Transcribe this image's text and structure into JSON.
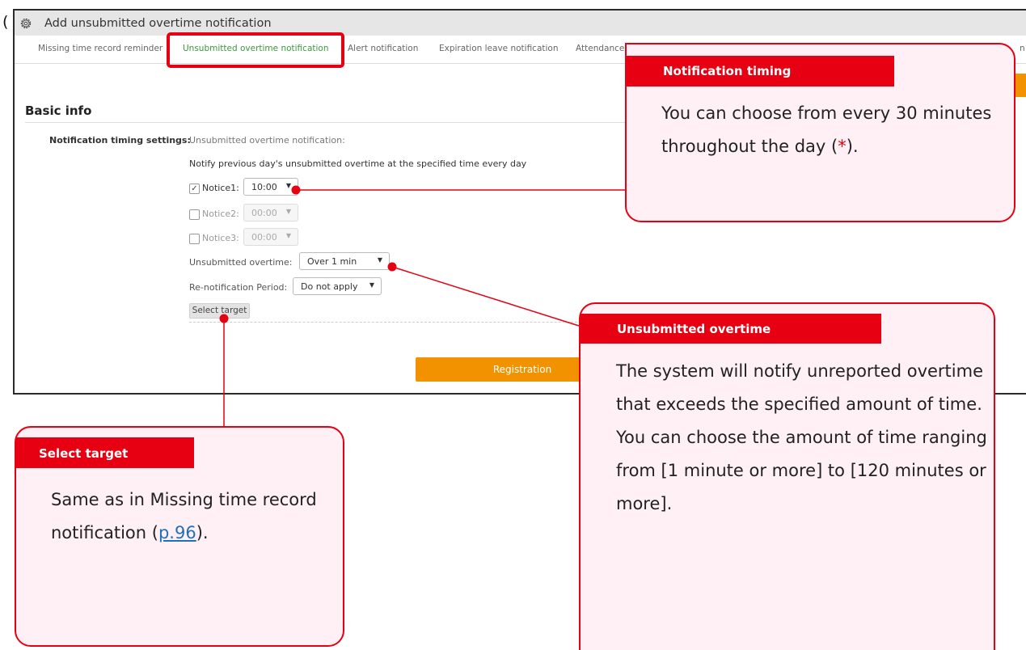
{
  "window": {
    "title": "Add unsubmitted overtime notification",
    "stray_char": "("
  },
  "tabs": [
    {
      "label": "Missing time record reminder",
      "active": false
    },
    {
      "label": "Unsubmitted overtime notification",
      "active": true
    },
    {
      "label": "Alert notification",
      "active": false
    },
    {
      "label": "Expiration leave notification",
      "active": false
    },
    {
      "label": "Attendance",
      "active": false
    },
    {
      "label": "n",
      "active": false
    }
  ],
  "section": {
    "title": "Basic info"
  },
  "form": {
    "timing_label": "Notification timing settings:",
    "timing_value": "Unsubmitted overtime notification:",
    "notify_text": "Notify previous day's unsubmitted overtime at the specified time every day",
    "notices": [
      {
        "label": "Notice1:",
        "value": "10:00",
        "checked": true,
        "checkmark": "✓"
      },
      {
        "label": "Notice2:",
        "value": "00:00",
        "checked": false,
        "checkmark": ""
      },
      {
        "label": "Notice3:",
        "value": "00:00",
        "checked": false,
        "checkmark": ""
      }
    ],
    "overtime_label": "Unsubmitted overtime:",
    "overtime_value": "Over 1 min",
    "renotify_label": "Re-notification Period:",
    "renotify_value": "Do not apply",
    "select_target_label": "Select target",
    "registration_label": "Registration"
  },
  "callouts": {
    "timing": {
      "title": "Notification timing",
      "body": "You can choose from every 30 minutes throughout the day (",
      "star": "*",
      "body_end": ")."
    },
    "overtime": {
      "title": "Unsubmitted overtime",
      "body": "The system will notify unreported overtime that exceeds the specified amount of time. You can choose the amount of time ranging from [1 minute or more] to [120 minutes or more]."
    },
    "target": {
      "title": "Select target",
      "body": "Same as in Missing time record notification (",
      "link_prefix": "p.",
      "link": "96",
      "body_end": ")."
    }
  },
  "icons": {
    "gear": "gear-icon",
    "dropdown": "caret-down-icon"
  },
  "colors": {
    "accent_red": "#e60012",
    "callout_bg": "#fff0f5",
    "button_orange": "#f39200",
    "active_tab": "#3a9a3a",
    "link_blue": "#1f6fbf"
  }
}
